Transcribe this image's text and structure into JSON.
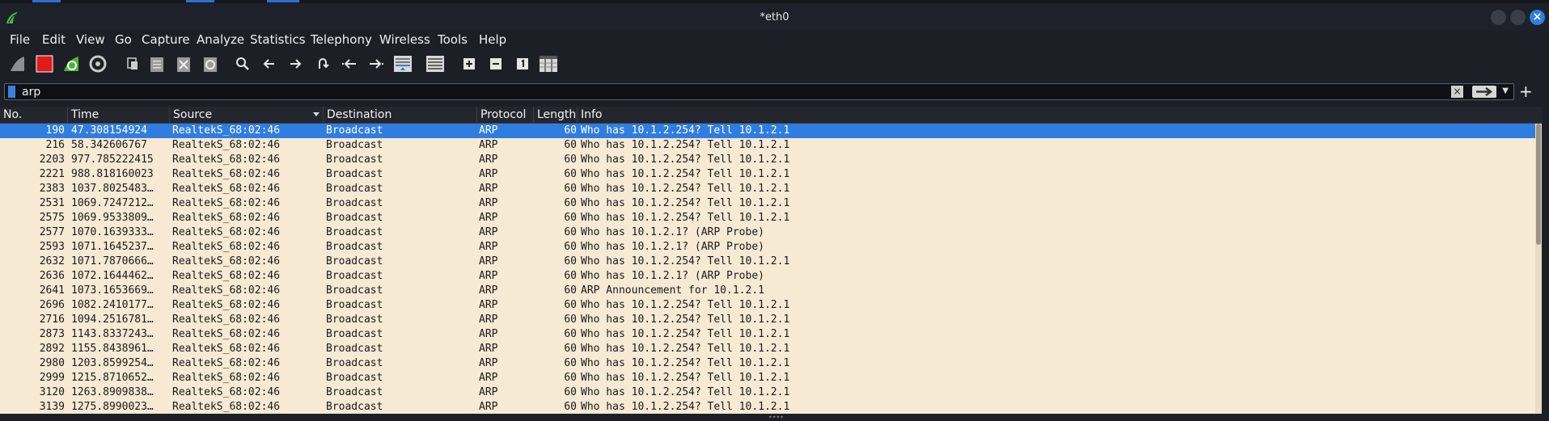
{
  "window": {
    "title": "*eth0"
  },
  "menu": [
    "File",
    "Edit",
    "View",
    "Go",
    "Capture",
    "Analyze",
    "Statistics",
    "Telephony",
    "Wireless",
    "Tools",
    "Help"
  ],
  "toolbar": {
    "icons": [
      "shark-fin-icon",
      "stop-capture-icon",
      "restart-capture-icon",
      "capture-options-icon",
      "open-file-icon",
      "save-file-icon",
      "close-file-icon",
      "reload-file-icon",
      "find-packet-icon",
      "go-back-icon",
      "go-forward-icon",
      "go-to-packet-icon",
      "go-first-packet-icon",
      "go-last-packet-icon",
      "autoscroll-icon",
      "colorize-icon",
      "zoom-in-icon",
      "zoom-out-icon",
      "normal-size-icon",
      "resize-columns-icon"
    ]
  },
  "filter": {
    "value": "arp"
  },
  "columns": [
    "No.",
    "Time",
    "Source",
    "Destination",
    "Protocol",
    "Length",
    "Info"
  ],
  "packets": [
    {
      "no": "190",
      "time": "47.308154924",
      "source": "RealtekS_68:02:46",
      "destination": "Broadcast",
      "protocol": "ARP",
      "length": "60",
      "info": "Who has 10.1.2.254? Tell 10.1.2.1",
      "selected": true
    },
    {
      "no": "216",
      "time": "58.342606767",
      "source": "RealtekS_68:02:46",
      "destination": "Broadcast",
      "protocol": "ARP",
      "length": "60",
      "info": "Who has 10.1.2.254? Tell 10.1.2.1"
    },
    {
      "no": "2203",
      "time": "977.785222415",
      "source": "RealtekS_68:02:46",
      "destination": "Broadcast",
      "protocol": "ARP",
      "length": "60",
      "info": "Who has 10.1.2.254? Tell 10.1.2.1"
    },
    {
      "no": "2221",
      "time": "988.818160023",
      "source": "RealtekS_68:02:46",
      "destination": "Broadcast",
      "protocol": "ARP",
      "length": "60",
      "info": "Who has 10.1.2.254? Tell 10.1.2.1"
    },
    {
      "no": "2383",
      "time": "1037.8025483…",
      "source": "RealtekS_68:02:46",
      "destination": "Broadcast",
      "protocol": "ARP",
      "length": "60",
      "info": "Who has 10.1.2.254? Tell 10.1.2.1"
    },
    {
      "no": "2531",
      "time": "1069.7247212…",
      "source": "RealtekS_68:02:46",
      "destination": "Broadcast",
      "protocol": "ARP",
      "length": "60",
      "info": "Who has 10.1.2.254? Tell 10.1.2.1"
    },
    {
      "no": "2575",
      "time": "1069.9533809…",
      "source": "RealtekS_68:02:46",
      "destination": "Broadcast",
      "protocol": "ARP",
      "length": "60",
      "info": "Who has 10.1.2.254? Tell 10.1.2.1"
    },
    {
      "no": "2577",
      "time": "1070.1639333…",
      "source": "RealtekS_68:02:46",
      "destination": "Broadcast",
      "protocol": "ARP",
      "length": "60",
      "info": "Who has 10.1.2.1? (ARP Probe)"
    },
    {
      "no": "2593",
      "time": "1071.1645237…",
      "source": "RealtekS_68:02:46",
      "destination": "Broadcast",
      "protocol": "ARP",
      "length": "60",
      "info": "Who has 10.1.2.1? (ARP Probe)"
    },
    {
      "no": "2632",
      "time": "1071.7870666…",
      "source": "RealtekS_68:02:46",
      "destination": "Broadcast",
      "protocol": "ARP",
      "length": "60",
      "info": "Who has 10.1.2.254? Tell 10.1.2.1"
    },
    {
      "no": "2636",
      "time": "1072.1644462…",
      "source": "RealtekS_68:02:46",
      "destination": "Broadcast",
      "protocol": "ARP",
      "length": "60",
      "info": "Who has 10.1.2.1? (ARP Probe)"
    },
    {
      "no": "2641",
      "time": "1073.1653669…",
      "source": "RealtekS_68:02:46",
      "destination": "Broadcast",
      "protocol": "ARP",
      "length": "60",
      "info": "ARP Announcement for 10.1.2.1"
    },
    {
      "no": "2696",
      "time": "1082.2410177…",
      "source": "RealtekS_68:02:46",
      "destination": "Broadcast",
      "protocol": "ARP",
      "length": "60",
      "info": "Who has 10.1.2.254? Tell 10.1.2.1"
    },
    {
      "no": "2716",
      "time": "1094.2516781…",
      "source": "RealtekS_68:02:46",
      "destination": "Broadcast",
      "protocol": "ARP",
      "length": "60",
      "info": "Who has 10.1.2.254? Tell 10.1.2.1"
    },
    {
      "no": "2873",
      "time": "1143.8337243…",
      "source": "RealtekS_68:02:46",
      "destination": "Broadcast",
      "protocol": "ARP",
      "length": "60",
      "info": "Who has 10.1.2.254? Tell 10.1.2.1"
    },
    {
      "no": "2892",
      "time": "1155.8438961…",
      "source": "RealtekS_68:02:46",
      "destination": "Broadcast",
      "protocol": "ARP",
      "length": "60",
      "info": "Who has 10.1.2.254? Tell 10.1.2.1"
    },
    {
      "no": "2980",
      "time": "1203.8599254…",
      "source": "RealtekS_68:02:46",
      "destination": "Broadcast",
      "protocol": "ARP",
      "length": "60",
      "info": "Who has 10.1.2.254? Tell 10.1.2.1"
    },
    {
      "no": "2999",
      "time": "1215.8710652…",
      "source": "RealtekS_68:02:46",
      "destination": "Broadcast",
      "protocol": "ARP",
      "length": "60",
      "info": "Who has 10.1.2.254? Tell 10.1.2.1"
    },
    {
      "no": "3120",
      "time": "1263.8909838…",
      "source": "RealtekS_68:02:46",
      "destination": "Broadcast",
      "protocol": "ARP",
      "length": "60",
      "info": "Who has 10.1.2.254? Tell 10.1.2.1"
    },
    {
      "no": "3139",
      "time": "1275.8990023…",
      "source": "RealtekS_68:02:46",
      "destination": "Broadcast",
      "protocol": "ARP",
      "length": "60",
      "info": "Who has 10.1.2.254? Tell 10.1.2.1"
    }
  ],
  "colors": {
    "selection": "#2f7de1",
    "arp_row_bg": "#f6ead4",
    "window_bg": "#1c1f26"
  }
}
